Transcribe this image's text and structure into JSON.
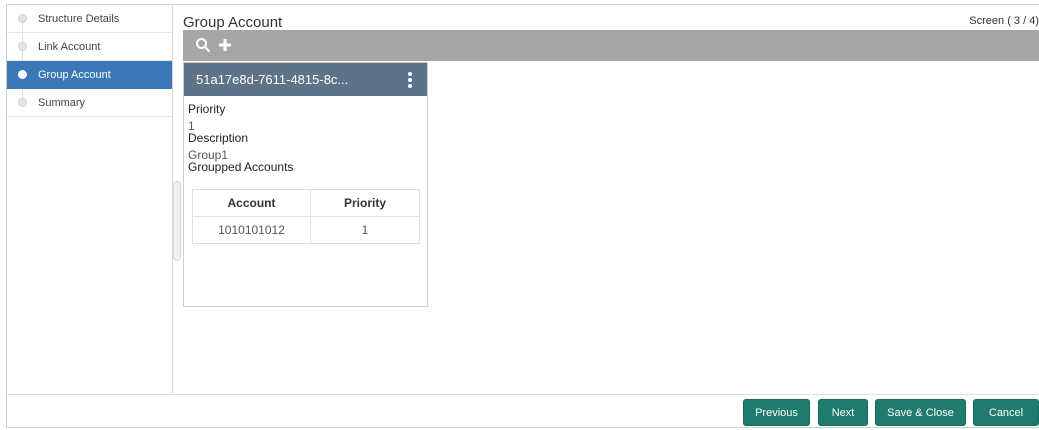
{
  "sidebar": {
    "items": [
      {
        "label": "Structure Details",
        "active": false
      },
      {
        "label": "Link Account",
        "active": false
      },
      {
        "label": "Group Account",
        "active": true
      },
      {
        "label": "Summary",
        "active": false
      }
    ]
  },
  "header": {
    "title": "Group Account",
    "screen_indicator": "Screen ( 3 / 4)"
  },
  "toolbar": {
    "icons": [
      "search-icon",
      "add-icon"
    ]
  },
  "card": {
    "title": "51a17e8d-7611-4815-8c...",
    "priority_label": "Priority",
    "priority_value": "1",
    "description_label": "Description",
    "description_value": "Group1",
    "grouped_label": "Groupped Accounts",
    "table": {
      "headers": [
        "Account",
        "Priority"
      ],
      "rows": [
        [
          "1010101012",
          "1"
        ]
      ]
    }
  },
  "footer": {
    "previous_label": "Previous",
    "next_label": "Next",
    "save_close_label": "Save & Close",
    "cancel_label": "Cancel"
  },
  "colors": {
    "active_step": "#3b78b7",
    "toolbar": "#a6a6a6",
    "card_header": "#5e7288",
    "button": "#1e7b6e"
  }
}
